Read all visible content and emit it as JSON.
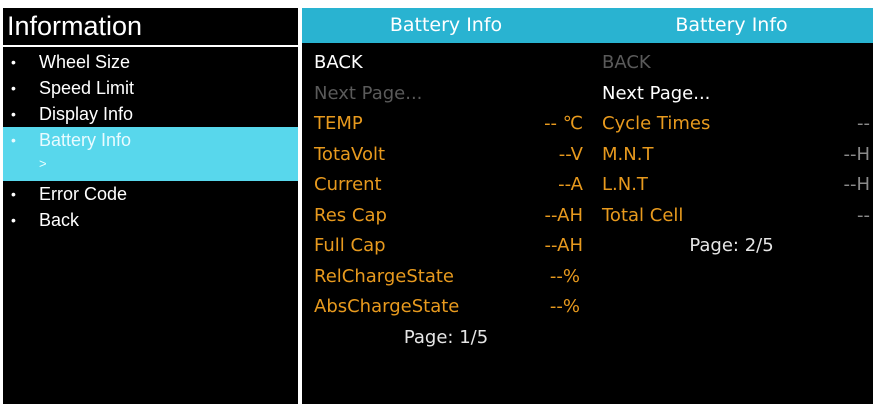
{
  "information": {
    "title": "Information",
    "bullet": "•",
    "items": [
      {
        "label": "Wheel Size"
      },
      {
        "label": "Speed Limit"
      },
      {
        "label": "Display Info"
      },
      {
        "label": "Battery Info",
        "sub": ">",
        "selected": true
      },
      {
        "label": "Error Code"
      },
      {
        "label": "Back"
      }
    ]
  },
  "page1": {
    "header": "Battery Info",
    "back": "BACK",
    "next": "Next Page...",
    "rows": [
      {
        "label": "TEMP",
        "value": "-- ℃"
      },
      {
        "label": "TotaVolt",
        "value": "--V"
      },
      {
        "label": "Current",
        "value": "--A"
      },
      {
        "label": "Res Cap",
        "value": "--AH"
      },
      {
        "label": "Full Cap",
        "value": "--AH"
      },
      {
        "label": "RelChargeState",
        "value": "--%"
      },
      {
        "label": "AbsChargeState",
        "value": "--%"
      }
    ],
    "page": "Page: 1/5"
  },
  "page2": {
    "header": "Battery Info",
    "back": "BACK",
    "next": "Next Page...",
    "rows": [
      {
        "label": "Cycle Times",
        "value": "--"
      },
      {
        "label": "M.N.T",
        "value": "--H"
      },
      {
        "label": "L.N.T",
        "value": "--H"
      },
      {
        "label": "Total Cell",
        "value": "--"
      }
    ],
    "page": "Page: 2/5"
  },
  "colors": {
    "header": "#29b3d1",
    "selected": "#58d7ec",
    "label": "#e89a1e",
    "background": "#000000"
  }
}
